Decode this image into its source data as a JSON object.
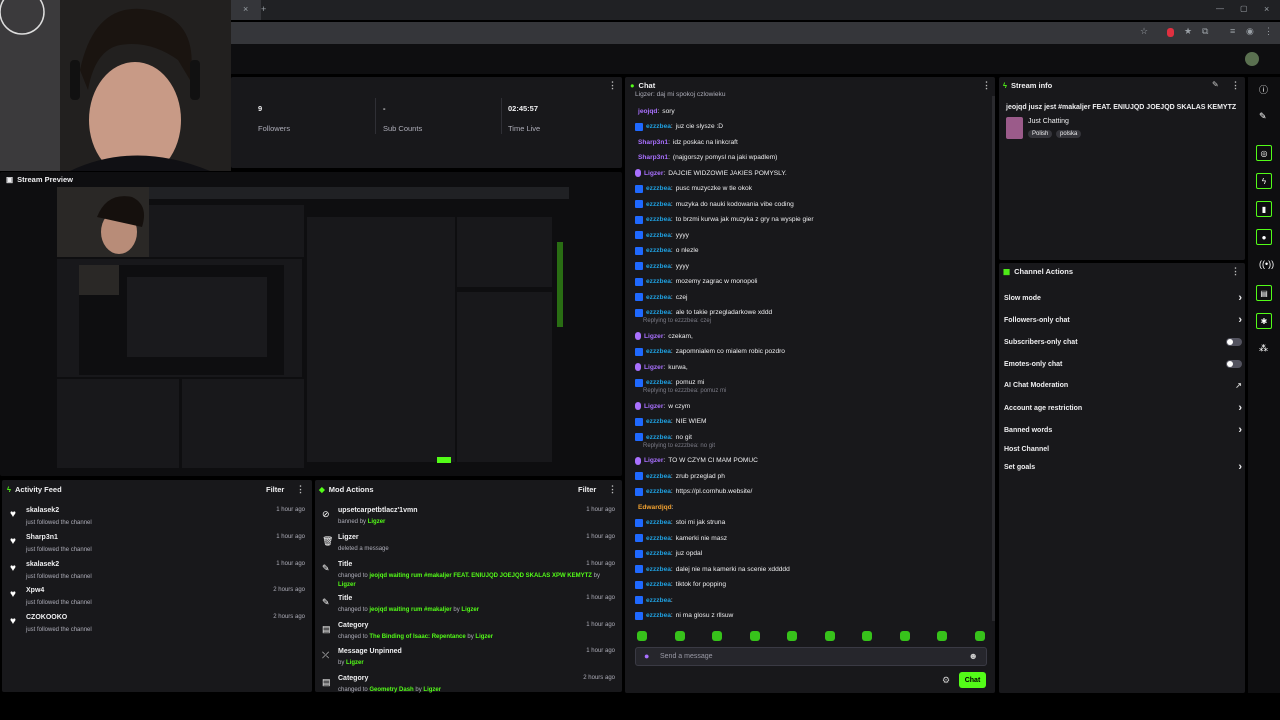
{
  "stats": [
    {
      "value": "9",
      "label": "Followers"
    },
    {
      "value": "-",
      "label": "Sub Counts"
    },
    {
      "value": "02:45:57",
      "label": "Time Live"
    }
  ],
  "preview": {
    "title": "Stream Preview"
  },
  "chat": {
    "title": "Chat",
    "top_partial": "Ligzer: daj mi spokoj czlowieku",
    "messages": [
      {
        "user": "jeojqd",
        "text": "sory",
        "color": "#a970ff",
        "badge": ""
      },
      {
        "user": "ezzzbea",
        "text": "juz cie slysze :D",
        "color": "#1fa0e0",
        "badge": "#1f69ff"
      },
      {
        "user": "Sharp3n1",
        "text": "idz poskac na linkcraft",
        "color": "#a970ff",
        "badge": ""
      },
      {
        "user": "Sharp3n1",
        "text": "(najgorszy pomysl na jaki wpadlem)",
        "color": "#a970ff",
        "badge": ""
      },
      {
        "user": "Ligzer",
        "text": "DAJCIE WIDZOWIE JAKIES POMYSLY.",
        "color": "#a970ff",
        "badge": "mic"
      },
      {
        "user": "ezzzbea",
        "text": "pusc muzyczke w tle okok",
        "color": "#1fa0e0",
        "badge": "#1f69ff"
      },
      {
        "user": "ezzzbea",
        "text": "muzyka do nauki kodowania vibe coding",
        "color": "#1fa0e0",
        "badge": "#1f69ff"
      },
      {
        "user": "ezzzbea",
        "text": "to brzmi kurwa jak muzyka z gry na wyspie gier",
        "color": "#1fa0e0",
        "badge": "#1f69ff"
      },
      {
        "user": "ezzzbea",
        "text": "yyyy",
        "color": "#1fa0e0",
        "badge": "#1f69ff"
      },
      {
        "user": "ezzzbea",
        "text": "o nlezle",
        "color": "#1fa0e0",
        "badge": "#1f69ff"
      },
      {
        "user": "ezzzbea",
        "text": "yyyy",
        "color": "#1fa0e0",
        "badge": "#1f69ff"
      },
      {
        "user": "ezzzbea",
        "text": "mozemy zagrac w monopoli",
        "color": "#1fa0e0",
        "badge": "#1f69ff"
      },
      {
        "user": "ezzzbea",
        "text": "czej",
        "color": "#1fa0e0",
        "badge": "#1f69ff"
      },
      {
        "user": "ezzzbea",
        "text": "ale to takie przegladarkowe xddd",
        "color": "#1fa0e0",
        "badge": "#1f69ff"
      }
    ],
    "reply1": "Replying to ezzzbea: czej",
    "messages2": [
      {
        "user": "Ligzer",
        "text": "czekam,",
        "color": "#a970ff",
        "badge": "mic"
      },
      {
        "user": "ezzzbea",
        "text": "zapomnialem co mialem robic pozdro",
        "color": "#1fa0e0",
        "badge": "#1f69ff"
      },
      {
        "user": "Ligzer",
        "text": "kurwa,",
        "color": "#a970ff",
        "badge": "mic"
      },
      {
        "user": "ezzzbea",
        "text": "pomuz mi",
        "color": "#1fa0e0",
        "badge": "#1f69ff"
      }
    ],
    "reply2": "Replying to ezzzbea: pomuz mi",
    "messages3": [
      {
        "user": "Ligzer",
        "text": "w czym",
        "color": "#a970ff",
        "badge": "mic"
      },
      {
        "user": "ezzzbea",
        "text": "NIE WIEM",
        "color": "#1fa0e0",
        "badge": "#1f69ff"
      },
      {
        "user": "ezzzbea",
        "text": "no git",
        "color": "#1fa0e0",
        "badge": "#1f69ff"
      }
    ],
    "reply3": "Replying to ezzzbea: no git",
    "messages4": [
      {
        "user": "Ligzer",
        "text": "TO W CZYM CI MAM POMUC",
        "color": "#a970ff",
        "badge": "mic"
      },
      {
        "user": "ezzzbea",
        "text": "zrub przeglad ph",
        "color": "#1fa0e0",
        "badge": "#1f69ff"
      },
      {
        "user": "ezzzbea",
        "text": "https://pl.cornhub.website/",
        "color": "#1fa0e0",
        "badge": "#1f69ff"
      },
      {
        "user": "Edwardjqd",
        "text": "",
        "color": "#f0a030",
        "badge": ""
      },
      {
        "user": "ezzzbea",
        "text": "stoi mi jak struna",
        "color": "#1fa0e0",
        "badge": "#1f69ff"
      },
      {
        "user": "ezzzbea",
        "text": "kamerki nie masz",
        "color": "#1fa0e0",
        "badge": "#1f69ff"
      },
      {
        "user": "ezzzbea",
        "text": "juz opdal",
        "color": "#1fa0e0",
        "badge": "#1f69ff"
      },
      {
        "user": "ezzzbea",
        "text": "dalej nie ma kamerki na scenie xddddd",
        "color": "#1fa0e0",
        "badge": "#1f69ff"
      },
      {
        "user": "ezzzbea",
        "text": "tiktok for popping",
        "color": "#1fa0e0",
        "badge": "#1f69ff"
      },
      {
        "user": "ezzzbea",
        "text": "",
        "color": "#1fa0e0",
        "badge": "#1f69ff"
      },
      {
        "user": "ezzzbea",
        "text": "ni ma glosu z rllsuw",
        "color": "#1fa0e0",
        "badge": "#1f69ff"
      }
    ],
    "input_placeholder": "Send a message",
    "send_label": "Chat"
  },
  "stream_info": {
    "title": "Stream info",
    "stream_title": "jeojqd jusz jest #makaljer FEAT. ENIUJQD JOEJQD SKALAS KEMYTZ",
    "category": "Just Chatting",
    "tags": [
      "Polish",
      "polska"
    ]
  },
  "channel_actions": {
    "title": "Channel Actions",
    "items": [
      {
        "label": "Slow mode",
        "control": "chevron"
      },
      {
        "label": "Followers-only chat",
        "control": "chevron"
      },
      {
        "label": "Subscribers-only chat",
        "control": "toggle"
      },
      {
        "label": "Emotes-only chat",
        "control": "toggle"
      },
      {
        "label": "AI Chat Moderation",
        "control": "external"
      },
      {
        "label": "Account age restriction",
        "control": "chevron"
      },
      {
        "label": "Banned words",
        "control": "chevron"
      },
      {
        "label": "Host Channel",
        "control": ""
      },
      {
        "label": "Set goals",
        "control": "chevron"
      }
    ]
  },
  "activity": {
    "title": "Activity Feed",
    "filter": "Filter",
    "items": [
      {
        "name": "skalasek2",
        "sub": "just followed the channel",
        "time": "1 hour ago"
      },
      {
        "name": "Sharp3n1",
        "sub": "just followed the channel",
        "time": "1 hour ago"
      },
      {
        "name": "skalasek2",
        "sub": "just followed the channel",
        "time": "1 hour ago"
      },
      {
        "name": "Xpw4",
        "sub": "just followed the channel",
        "time": "2 hours ago"
      },
      {
        "name": "CZOKOOKO",
        "sub": "just followed the channel",
        "time": "2 hours ago"
      }
    ]
  },
  "mod": {
    "title": "Mod Actions",
    "filter": "Filter",
    "items": [
      {
        "icon": "ban-icon",
        "glyph": "⊘",
        "name": "upsetcarpetbtlacz'1vmn",
        "pre": "banned by ",
        "val": "",
        "by": "Ligzer",
        "time": "1 hour ago"
      },
      {
        "icon": "trash-icon",
        "glyph": "🗑",
        "name": "Ligzer",
        "pre": "deleted a message",
        "val": "",
        "by": "",
        "time": "1 hour ago"
      },
      {
        "icon": "title-icon",
        "glyph": "✎",
        "name": "Title",
        "pre": "changed to ",
        "val": "jeojqd waiting rum #makaljer FEAT. ENIUJQD JOEJQD SKALAS XPW KEMYTZ",
        "by": "Ligzer",
        "time": "1 hour ago"
      },
      {
        "icon": "title-icon",
        "glyph": "✎",
        "name": "Title",
        "pre": "changed to ",
        "val": "jeojqd waiting rum #makaljer",
        "by": "Ligzer",
        "time": "1 hour ago"
      },
      {
        "icon": "category-icon",
        "glyph": "▤",
        "name": "Category",
        "pre": "changed to ",
        "val": "The Binding of Isaac: Repentance",
        "by": "Ligzer",
        "time": "1 hour ago"
      },
      {
        "icon": "unpin-icon",
        "glyph": "⤫",
        "name": "Message Unpinned",
        "pre": "by ",
        "val": "",
        "by": "Ligzer",
        "time": "1 hour ago"
      },
      {
        "icon": "category-icon",
        "glyph": "▤",
        "name": "Category",
        "pre": "changed to ",
        "val": "Geometry Dash",
        "by": "Ligzer",
        "time": "2 hours ago"
      }
    ]
  }
}
